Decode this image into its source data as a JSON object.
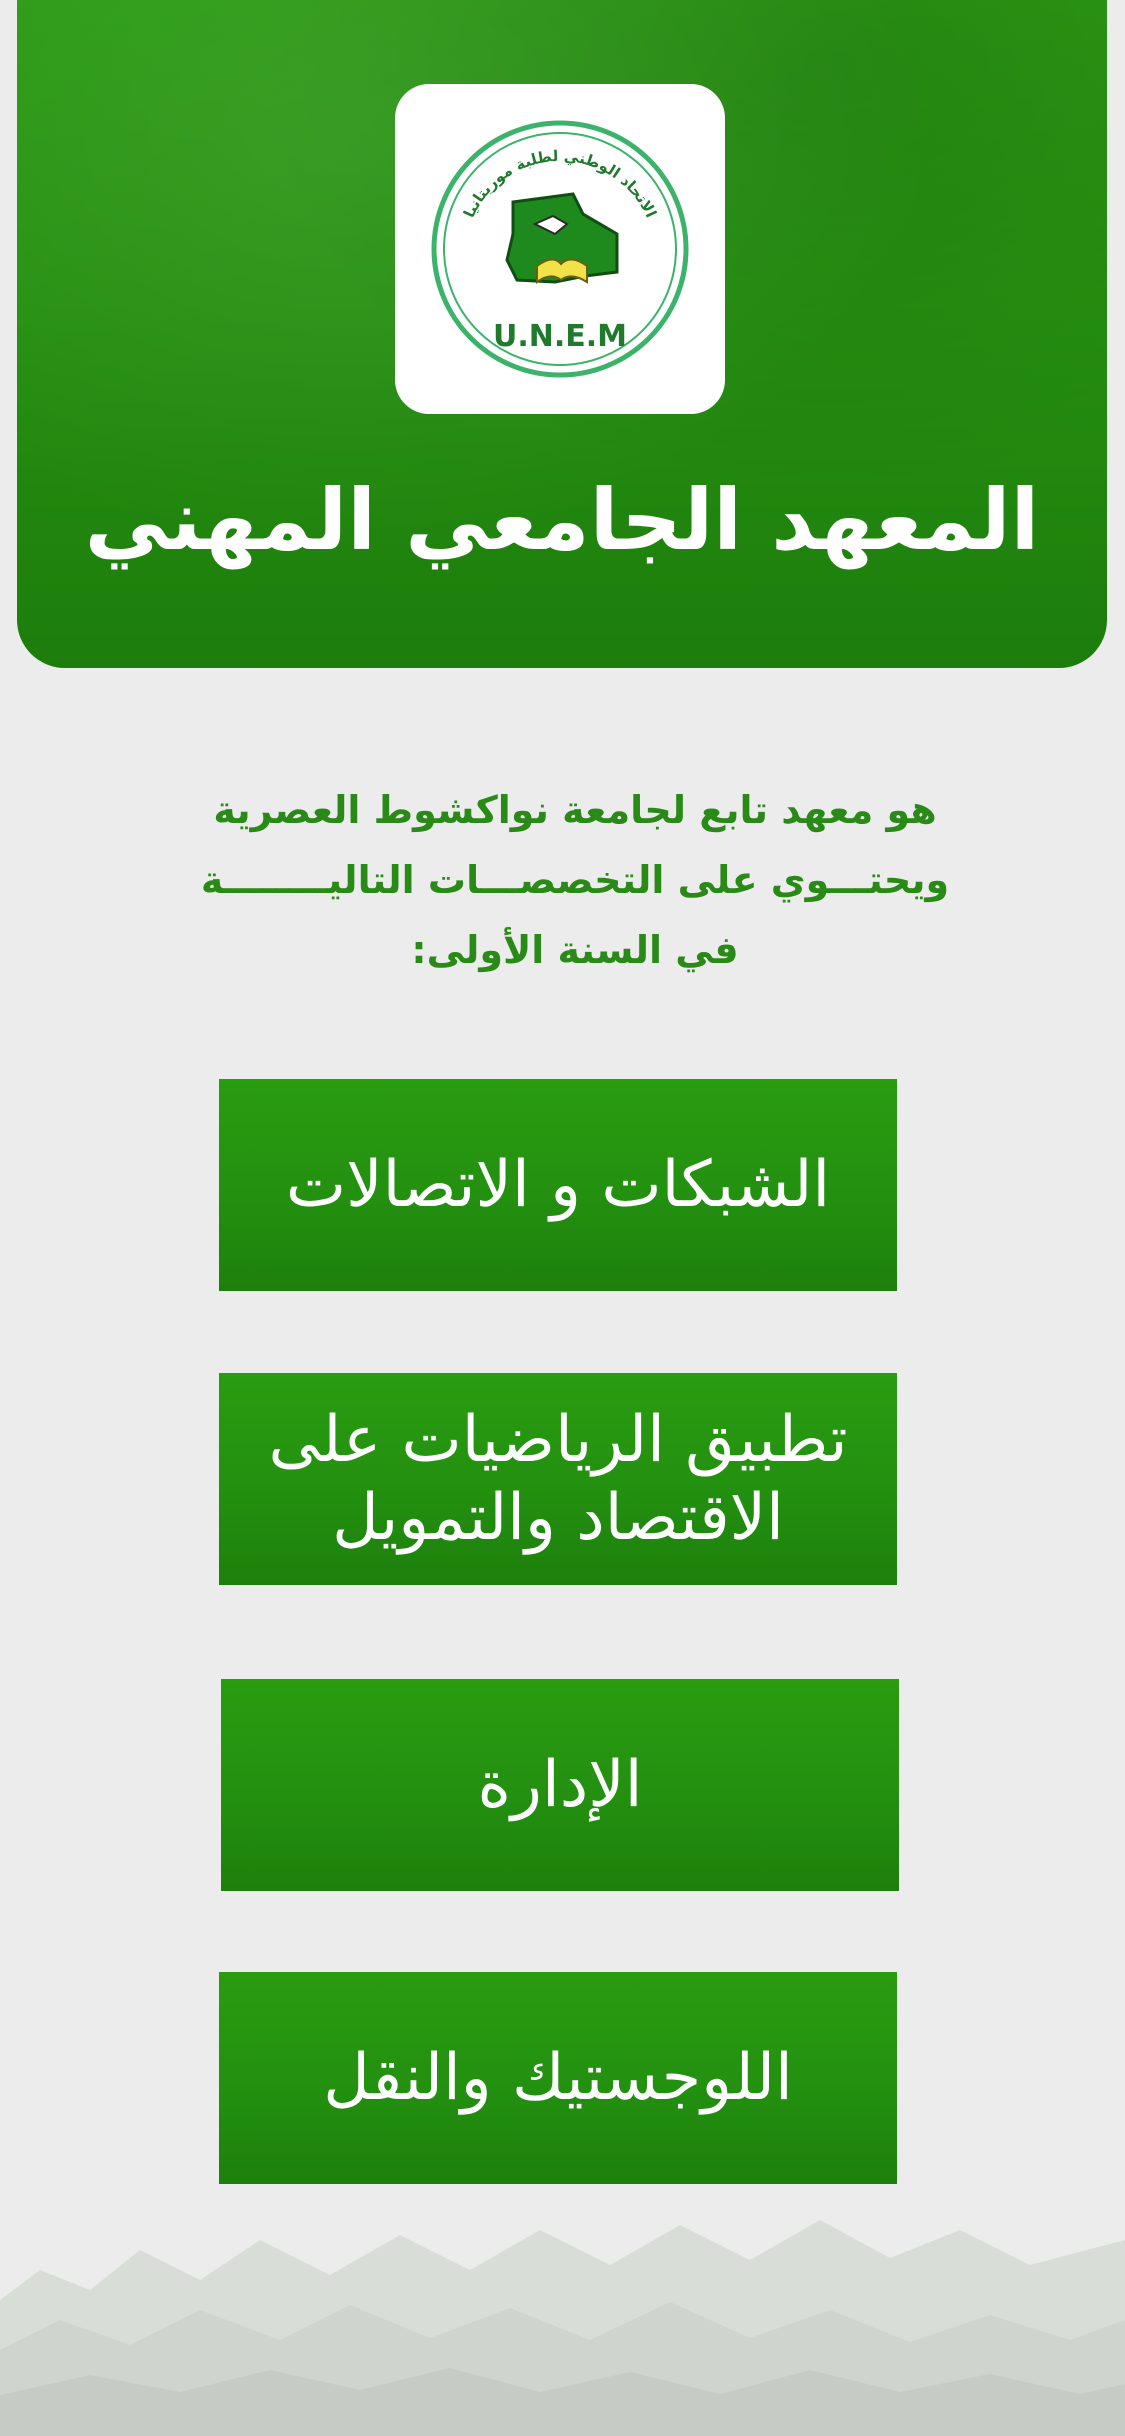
{
  "header": {
    "logo": {
      "arc_text": "الاتحاد الوطني لطلبة موريتانيا",
      "acronym": "U.N.E.M",
      "icon": "unem-logo-icon"
    },
    "title": "المعهد الجامعي المهني"
  },
  "intro": {
    "lines": [
      "هو معهد تابع لجامعة نواكشوط العصرية",
      "ويحتـــوي على التخصصـــات التاليــــــــة",
      "في السنة الأولى:"
    ]
  },
  "programs": [
    {
      "label": "الشبكات و الاتصالات"
    },
    {
      "label": "تطبيق الرياضيات على الاقتصاد والتمويل"
    },
    {
      "label": "الإدارة"
    },
    {
      "label": "اللوجستيك والنقل"
    }
  ],
  "colors": {
    "header_green": "#259010",
    "intro_text": "#2a8a17",
    "button_green": "#239010",
    "background": "#ececec"
  }
}
